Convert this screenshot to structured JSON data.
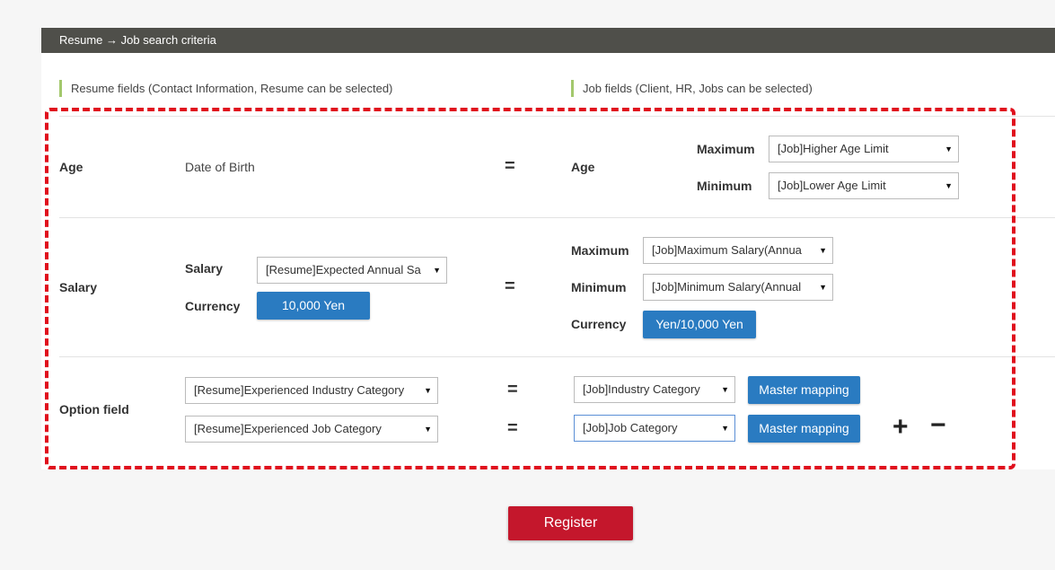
{
  "header": {
    "title": "Resume → Job search criteria"
  },
  "columns": {
    "resume_label": "Resume fields (Contact Information, Resume can be selected)",
    "job_label": "Job fields (Client, HR, Jobs can be selected)"
  },
  "equals": "=",
  "age": {
    "label": "Age",
    "resume_value": "Date of Birth",
    "job_label": "Age",
    "max_label": "Maximum",
    "max_select": "[Job]Higher Age Limit",
    "min_label": "Minimum",
    "min_select": "[Job]Lower Age Limit"
  },
  "salary": {
    "label": "Salary",
    "resume_salary_label": "Salary",
    "resume_salary_select": "[Resume]Expected Annual Sa",
    "resume_currency_label": "Currency",
    "resume_currency_button": "10,000 Yen",
    "max_label": "Maximum",
    "max_select": "[Job]Maximum Salary(Annua",
    "min_label": "Minimum",
    "min_select": "[Job]Minimum Salary(Annual",
    "job_currency_label": "Currency",
    "job_currency_button": "Yen/10,000 Yen"
  },
  "option": {
    "label": "Option field",
    "rows": [
      {
        "resume_select": "[Resume]Experienced Industry Category",
        "job_select": "[Job]Industry Category",
        "mapping_button": "Master mapping"
      },
      {
        "resume_select": "[Resume]Experienced Job Category",
        "job_select": "[Job]Job Category",
        "mapping_button": "Master mapping"
      }
    ],
    "add_symbol": "+",
    "remove_symbol": "−"
  },
  "register_button": "Register",
  "colors": {
    "accent_blue": "#2a7bc1",
    "register_red": "#c4172c",
    "dash_red": "#e0101d",
    "header_bg": "#4f4f4a"
  },
  "icons": {
    "dropdown": "triangle-down",
    "add": "plus",
    "remove": "minus"
  }
}
